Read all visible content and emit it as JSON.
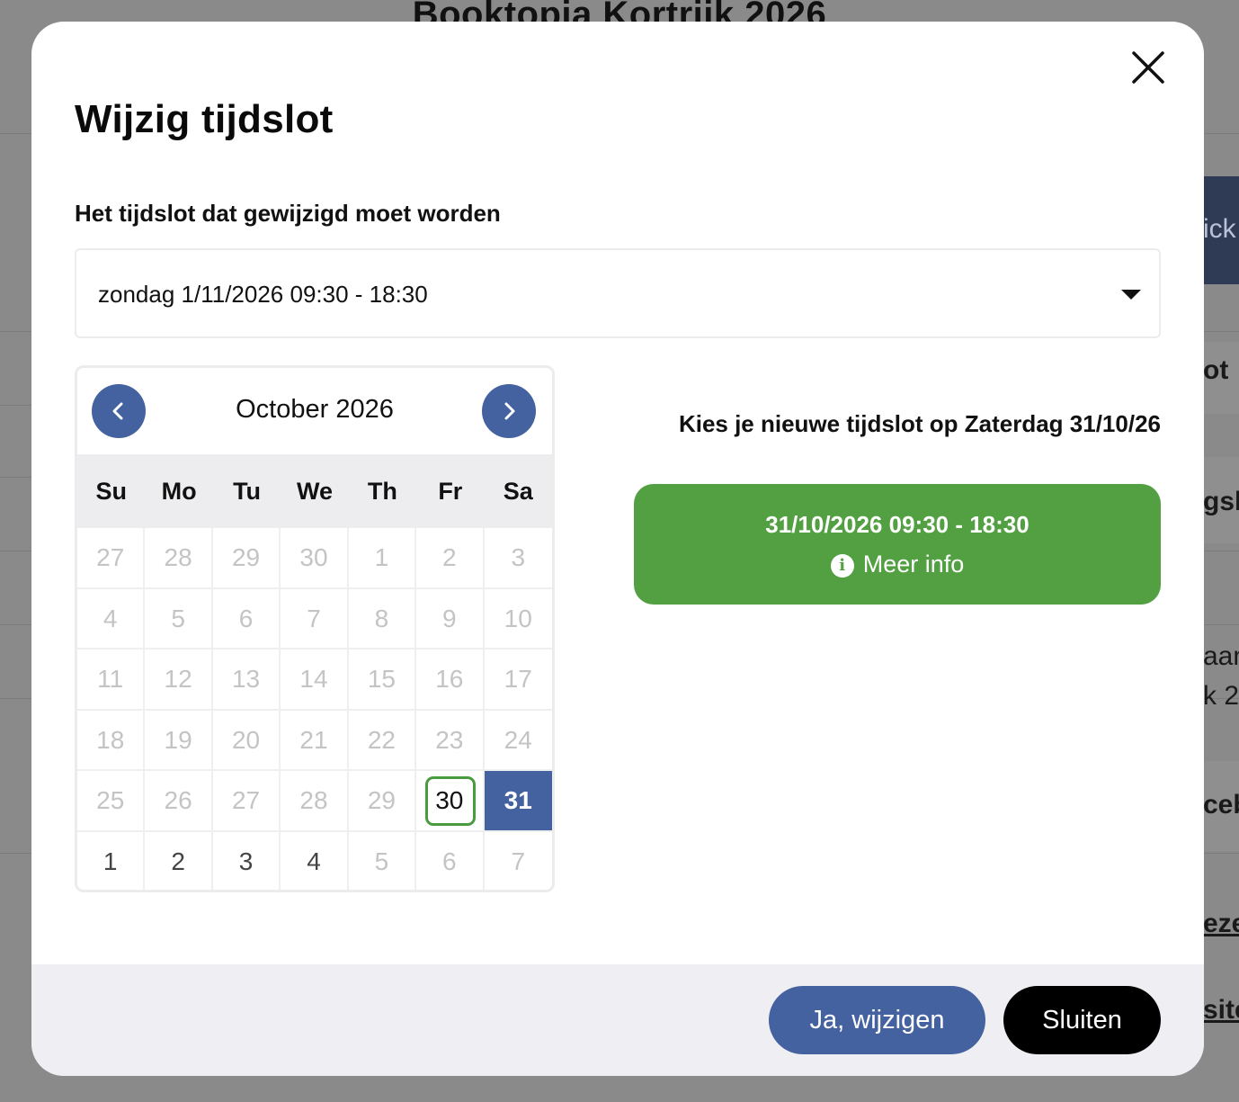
{
  "background": {
    "title": "Booktopia Kortrijk 2026",
    "fragments": [
      "ick",
      "ot",
      "gsb",
      "aan",
      "k 2",
      "ceb",
      "eze",
      "site"
    ]
  },
  "modal": {
    "title": "Wijzig tijdslot",
    "close_icon": "close-icon",
    "field_label": "Het tijdslot dat gewijzigd moet worden",
    "selected_slot": "zondag 1/11/2026 09:30 - 18:30"
  },
  "calendar": {
    "month_label": "October 2026",
    "weekdays": [
      "Su",
      "Mo",
      "Tu",
      "We",
      "Th",
      "Fr",
      "Sa"
    ],
    "days": [
      {
        "label": "27",
        "state": "disabled"
      },
      {
        "label": "28",
        "state": "disabled"
      },
      {
        "label": "29",
        "state": "disabled"
      },
      {
        "label": "30",
        "state": "disabled"
      },
      {
        "label": "1",
        "state": "disabled"
      },
      {
        "label": "2",
        "state": "disabled"
      },
      {
        "label": "3",
        "state": "disabled"
      },
      {
        "label": "4",
        "state": "disabled"
      },
      {
        "label": "5",
        "state": "disabled"
      },
      {
        "label": "6",
        "state": "disabled"
      },
      {
        "label": "7",
        "state": "disabled"
      },
      {
        "label": "8",
        "state": "disabled"
      },
      {
        "label": "9",
        "state": "disabled"
      },
      {
        "label": "10",
        "state": "disabled"
      },
      {
        "label": "11",
        "state": "disabled"
      },
      {
        "label": "12",
        "state": "disabled"
      },
      {
        "label": "13",
        "state": "disabled"
      },
      {
        "label": "14",
        "state": "disabled"
      },
      {
        "label": "15",
        "state": "disabled"
      },
      {
        "label": "16",
        "state": "disabled"
      },
      {
        "label": "17",
        "state": "disabled"
      },
      {
        "label": "18",
        "state": "disabled"
      },
      {
        "label": "19",
        "state": "disabled"
      },
      {
        "label": "20",
        "state": "disabled"
      },
      {
        "label": "21",
        "state": "disabled"
      },
      {
        "label": "22",
        "state": "disabled"
      },
      {
        "label": "23",
        "state": "disabled"
      },
      {
        "label": "24",
        "state": "disabled"
      },
      {
        "label": "25",
        "state": "disabled"
      },
      {
        "label": "26",
        "state": "disabled"
      },
      {
        "label": "27",
        "state": "disabled"
      },
      {
        "label": "28",
        "state": "disabled"
      },
      {
        "label": "29",
        "state": "disabled"
      },
      {
        "label": "30",
        "state": "today"
      },
      {
        "label": "31",
        "state": "selected"
      },
      {
        "label": "1",
        "state": "next-month"
      },
      {
        "label": "2",
        "state": "next-month"
      },
      {
        "label": "3",
        "state": "next-month"
      },
      {
        "label": "4",
        "state": "next-month"
      },
      {
        "label": "5",
        "state": "disabled"
      },
      {
        "label": "6",
        "state": "disabled"
      },
      {
        "label": "7",
        "state": "disabled"
      }
    ]
  },
  "slots": {
    "heading": "Kies je nieuwe tijdslot op Zaterdag 31/10/26",
    "items": [
      {
        "time": "31/10/2026 09:30 - 18:30",
        "info_label": "Meer info",
        "info_icon": "i"
      }
    ]
  },
  "footer": {
    "confirm_label": "Ja, wijzigen",
    "close_label": "Sluiten"
  },
  "colors": {
    "primary": "#4462a0",
    "slot_green": "#53a042",
    "today_ring": "#4a9a3f",
    "black_button": "#000000"
  }
}
